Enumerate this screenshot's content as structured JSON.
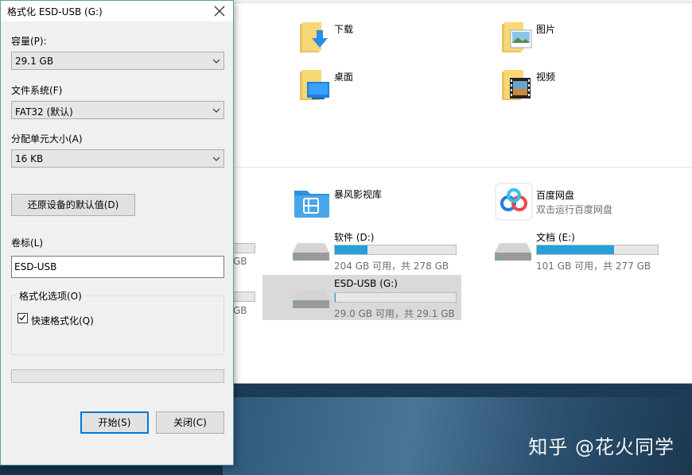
{
  "dialog": {
    "title": "格式化 ESD-USB (G:)",
    "capacity_label": "容量(P):",
    "capacity_value": "29.1 GB",
    "filesystem_label": "文件系统(F)",
    "filesystem_value": "FAT32 (默认)",
    "allocation_label": "分配单元大小(A)",
    "allocation_value": "16 KB",
    "restore_button": "还原设备的默认值(D)",
    "volume_label": "卷标(L)",
    "volume_value": "ESD-USB",
    "options_label": "格式化选项(O)",
    "quick_format_label": "快速格式化(Q)",
    "quick_format_checked": true,
    "progress": 0,
    "start_button": "开始(S)",
    "close_button": "关闭(C)"
  },
  "explorer": {
    "folders": [
      {
        "name": "下载",
        "icon": "downloads-folder-icon"
      },
      {
        "name": "图片",
        "icon": "pictures-folder-icon"
      },
      {
        "name": "桌面",
        "icon": "desktop-folder-icon"
      },
      {
        "name": "视频",
        "icon": "videos-folder-icon"
      }
    ],
    "apps": [
      {
        "name": "暴风影视库",
        "icon": "baofeng-icon"
      },
      {
        "name": "百度网盘",
        "subtitle": "双击运行百度网盘",
        "icon": "baidu-netdisk-icon"
      }
    ],
    "drives": [
      {
        "name": "软件 (D:)",
        "info": "204 GB 可用，共 278 GB",
        "used_fraction": 0.27
      },
      {
        "name": "文档 (E:)",
        "info": "101 GB 可用，共 277 GB",
        "used_fraction": 0.64
      },
      {
        "name": "ESD-USB (G:)",
        "info": "29.0 GB 可用，共 29.1 GB",
        "used_fraction": 0.003
      }
    ],
    "partial_texts": [
      "GB",
      "GB"
    ],
    "colors": {
      "bar_fill": "#26a0da",
      "selection": "#d9d9d9"
    }
  },
  "watermark": "知乎 @花火同学"
}
